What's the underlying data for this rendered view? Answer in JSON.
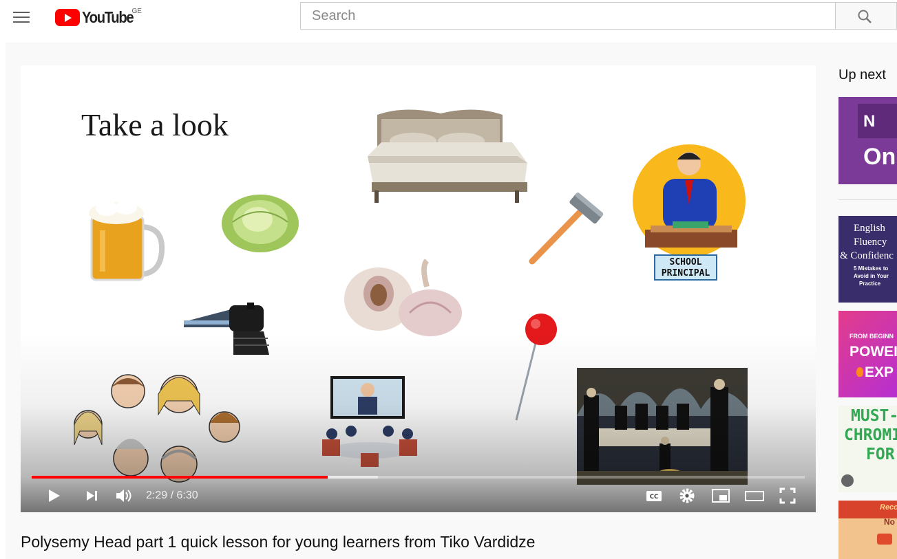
{
  "masthead": {
    "logo_text": "YouTube",
    "country_code": "GE",
    "search_placeholder": "Search"
  },
  "player": {
    "slide_title": "Take a look",
    "principal_label_line1": "SCHOOL",
    "principal_label_line2": "PRINCIPAL",
    "current_time": "2:29",
    "duration": "6:30",
    "time_separator": " / ",
    "progress_played": 0.383,
    "progress_buffered": 0.448,
    "colors": {
      "progress": "#ff0000",
      "brand": "#ff0000"
    }
  },
  "video": {
    "title": "Polysemy Head part 1 quick lesson for young learners from Tiko Vardidze"
  },
  "sidebar": {
    "heading": "Up next",
    "thumbnails": [
      {
        "lines": [
          "N",
          "On"
        ]
      },
      {
        "lines": [
          "English",
          "Fluency",
          "& Confidenc",
          "5 Mistakes to",
          "Avoid in Your",
          "Practice"
        ]
      },
      {
        "lines": [
          "FROM BEGINN",
          "POWEI",
          "EXP"
        ]
      },
      {
        "lines": [
          "MUST-",
          "CHROMI",
          "FOR"
        ]
      },
      {
        "lines": [
          "Record",
          "No"
        ]
      }
    ]
  }
}
